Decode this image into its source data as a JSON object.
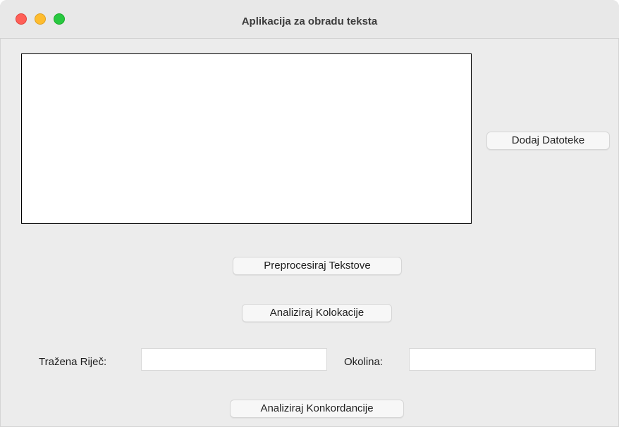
{
  "window": {
    "title": "Aplikacija za obradu teksta"
  },
  "file_list": {
    "items": []
  },
  "buttons": {
    "add_files": "Dodaj Datoteke",
    "preprocess": "Preprocesiraj Tekstove",
    "collocations": "Analiziraj Kolokacije",
    "concordance": "Analiziraj Konkordancije"
  },
  "search": {
    "word_label": "Tražena Riječ:",
    "word_value": "",
    "context_label": "Okolina:",
    "context_value": ""
  },
  "colors": {
    "close": "#ff5f57",
    "minimize": "#febc2e",
    "maximize": "#28c840",
    "window_bg": "#ececec"
  }
}
